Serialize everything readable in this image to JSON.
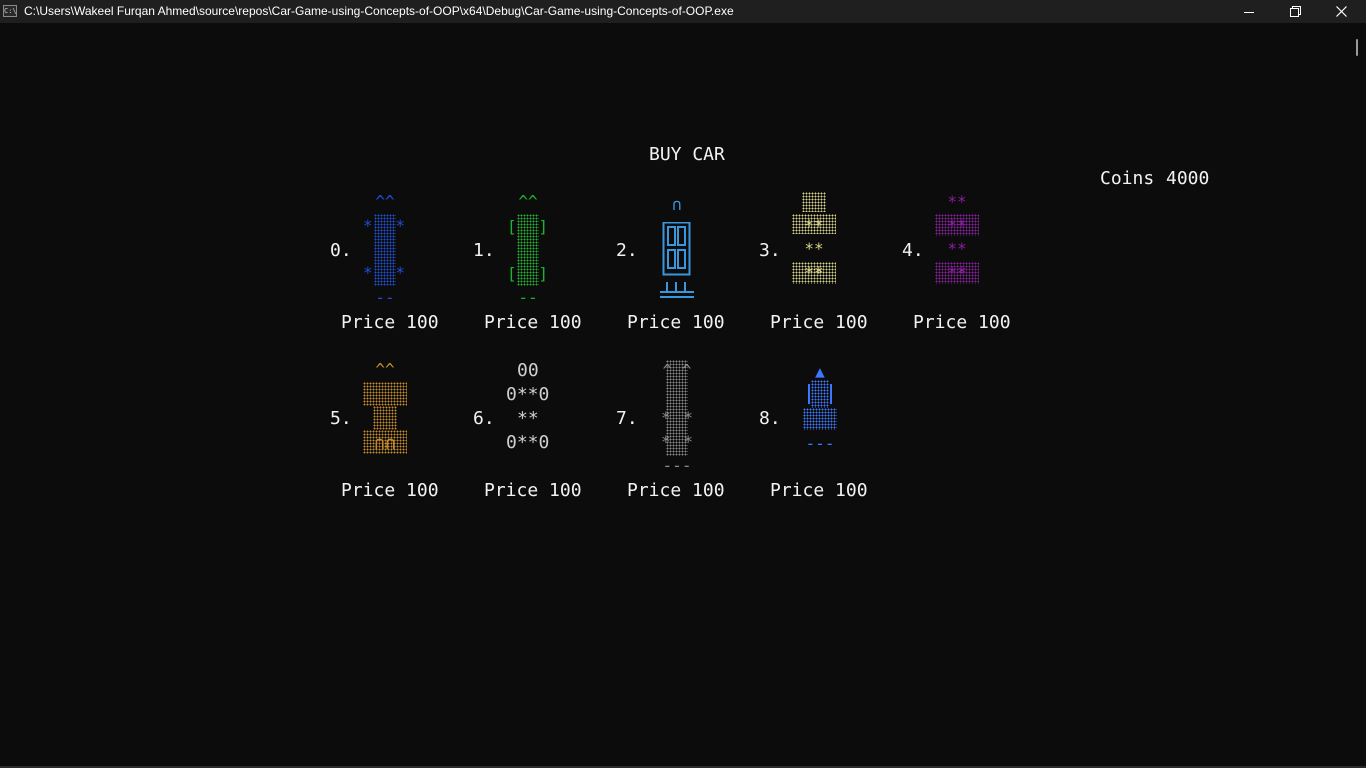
{
  "window": {
    "title": "C:\\Users\\Wakeel Furqan Ahmed\\source\\repos\\Car-Game-using-Concepts-of-OOP\\x64\\Debug\\Car-Game-using-Concepts-of-OOP.exe",
    "app_icon_text": "C:\\",
    "controls": [
      "minimize-icon",
      "maximize-icon",
      "close-icon"
    ]
  },
  "screen": {
    "heading": "BUY CAR",
    "coins_label": "Coins",
    "coins_value": "4000"
  },
  "cars": [
    {
      "index": "0.",
      "price": "Price 100",
      "color": "#1f4fd8",
      "top": "^^",
      "side": "*",
      "bottom": "--"
    },
    {
      "index": "1.",
      "price": "Price 100",
      "color": "#1db32d",
      "top": "^^",
      "side_left": "[",
      "side_right": "]",
      "bottom": "--"
    },
    {
      "index": "2.",
      "price": "Price 100",
      "color": "#3a96dd",
      "top": "∩"
    },
    {
      "index": "3.",
      "price": "Price 100",
      "color": "#d8d28a",
      "mark": "**"
    },
    {
      "index": "4.",
      "price": "Price 100",
      "color": "#8a1fa0",
      "mark": "**"
    },
    {
      "index": "5.",
      "price": "Price 100",
      "color": "#c58a2a",
      "top": "^^",
      "bottom": "∩∩"
    },
    {
      "index": "6.",
      "price": "Price 100",
      "color": "#cfcfcf",
      "lines": [
        "00",
        "0**0",
        "**",
        "0**0"
      ]
    },
    {
      "index": "7.",
      "price": "Price 100",
      "color": "#8a8a8a",
      "top": "^ ^",
      "side": "*",
      "bottom": "---"
    },
    {
      "index": "8.",
      "price": "Price 100",
      "color": "#3b78ff",
      "top": "▲",
      "bottom": "---"
    }
  ]
}
